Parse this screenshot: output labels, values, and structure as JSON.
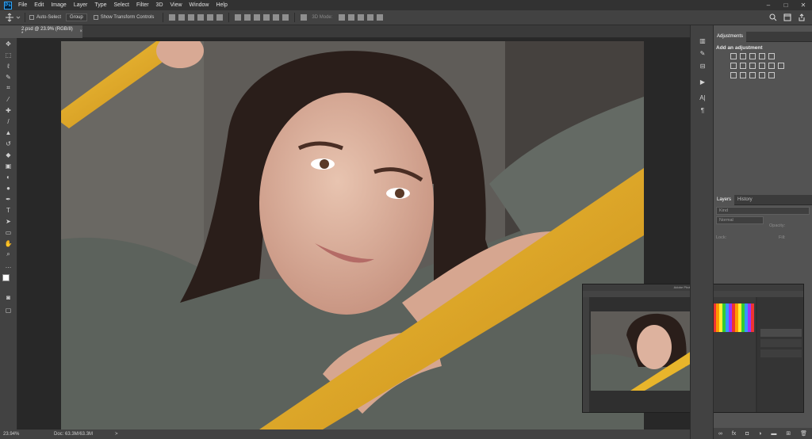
{
  "app": {
    "logo": "Ps"
  },
  "menu": [
    "File",
    "Edit",
    "Image",
    "Layer",
    "Type",
    "Select",
    "Filter",
    "3D",
    "View",
    "Window",
    "Help"
  ],
  "window_controls": {
    "minimize": "–",
    "maximize": "□",
    "close": "✕"
  },
  "options_bar": {
    "auto_select_label": "Auto-Select",
    "auto_select_value": "Group",
    "transform_label": "Show Transform Controls",
    "mode_label": "3D Mode:"
  },
  "document_tab": {
    "title": "2.psd @ 23.9% (RGB/8) *",
    "close": "×"
  },
  "status_bar": {
    "zoom": "23.94%",
    "doc_info": "Doc: 63.3M/63.3M",
    "arrow": ">"
  },
  "adjustments_panel": {
    "tab": "Adjustments",
    "title": "Add an adjustment"
  },
  "layers_panel": {
    "tabs": [
      "Layers",
      "History"
    ],
    "kind_placeholder": "Kind",
    "blend_mode": "Normal",
    "opacity_label": "Opacity:",
    "lock_label": "Lock:",
    "fill_label": "Fill:"
  },
  "overlay": {
    "title": "Adobe Photoshop CC 2018"
  },
  "icons": {
    "move": "move-icon",
    "marquee": "marquee-icon",
    "lasso": "lasso-icon",
    "magic_wand": "quick-select-icon",
    "crop": "crop-icon",
    "eyedropper": "eyedropper-icon",
    "heal": "healing-icon",
    "brush": "brush-icon",
    "stamp": "clone-stamp-icon",
    "history_brush": "history-brush-icon",
    "eraser": "eraser-icon",
    "gradient": "gradient-icon",
    "blur": "blur-icon",
    "dodge": "dodge-icon",
    "pen": "pen-icon",
    "type": "type-icon",
    "path_select": "path-select-icon",
    "shape": "rectangle-icon",
    "hand": "hand-icon",
    "zoom": "zoom-icon"
  },
  "colors": {
    "accent": "#31a8ff",
    "bg_dark": "#323232",
    "panel": "#535353",
    "rail": "#e8b52b"
  }
}
